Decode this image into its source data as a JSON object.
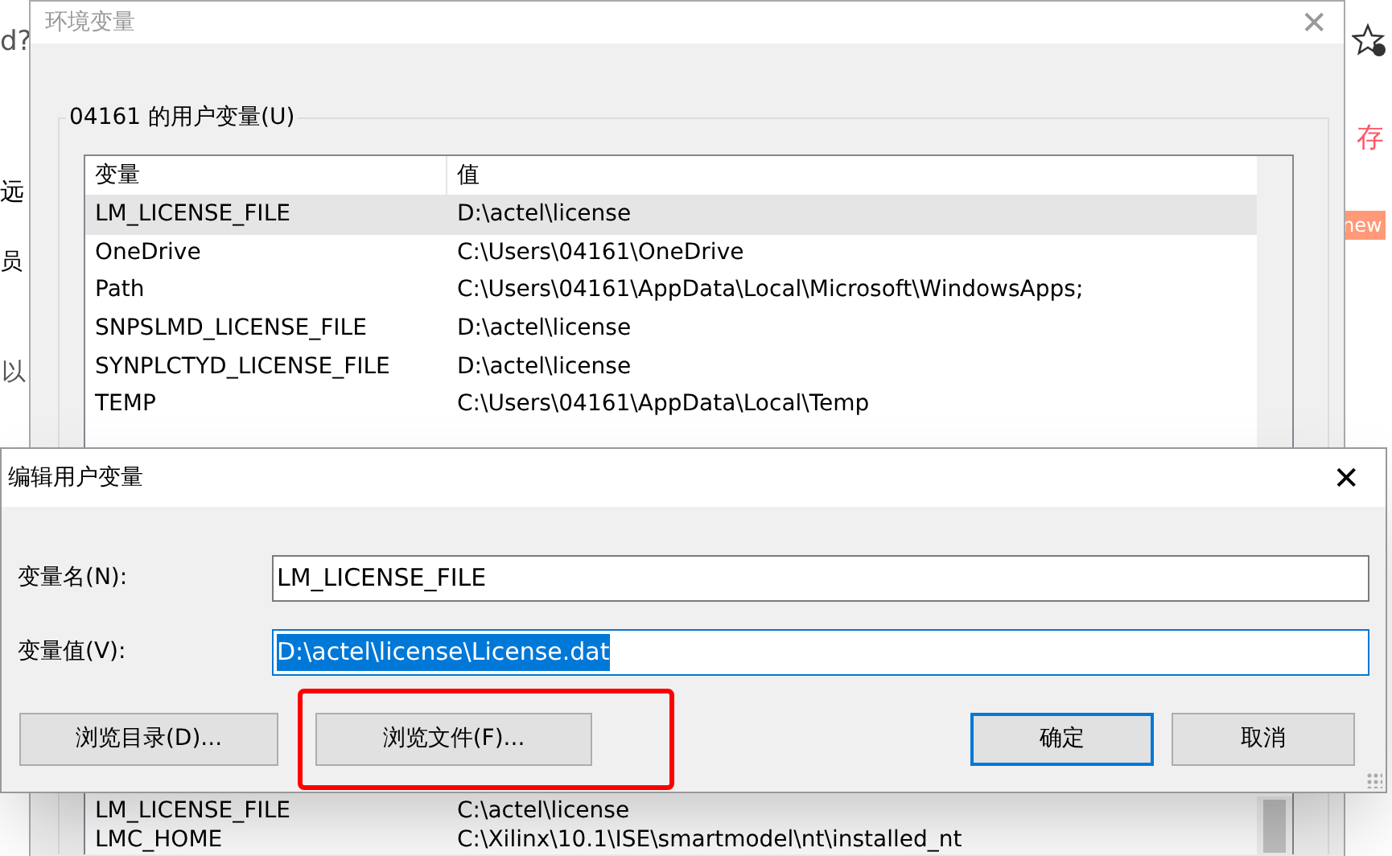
{
  "background_page": {
    "fragments": [
      {
        "text": "d?"
      },
      {
        "text": "远"
      },
      {
        "text": "员"
      },
      {
        "text": "以"
      }
    ],
    "right_fragments": [
      {
        "text": "存"
      },
      {
        "text": "new"
      }
    ]
  },
  "env_dialog": {
    "title": "环境变量",
    "close_glyph": "✕",
    "group_label": "04161 的用户变量(U)",
    "columns": [
      "变量",
      "值"
    ],
    "rows": [
      {
        "name": "LM_LICENSE_FILE",
        "value": "D:\\actel\\license",
        "selected": true
      },
      {
        "name": "OneDrive",
        "value": "C:\\Users\\04161\\OneDrive",
        "selected": false
      },
      {
        "name": "Path",
        "value": "C:\\Users\\04161\\AppData\\Local\\Microsoft\\WindowsApps;",
        "selected": false
      },
      {
        "name": "SNPSLMD_LICENSE_FILE",
        "value": "D:\\actel\\license",
        "selected": false
      },
      {
        "name": "SYNPLCTYD_LICENSE_FILE",
        "value": "D:\\actel\\license",
        "selected": false
      },
      {
        "name": "TEMP",
        "value": "C:\\Users\\04161\\AppData\\Local\\Temp",
        "selected": false
      }
    ],
    "lower_rows": [
      {
        "name": "LM_LICENSE_FILE",
        "value": "C:\\actel\\license"
      },
      {
        "name": "LMC_HOME",
        "value": "C:\\Xilinx\\10.1\\ISE\\smartmodel\\nt\\installed_nt"
      }
    ]
  },
  "edit_dialog": {
    "title": "编辑用户变量",
    "close_glyph": "✕",
    "fields": [
      {
        "label": "变量名(N):",
        "value": "LM_LICENSE_FILE",
        "text_selected": false
      },
      {
        "label": "变量值(V):",
        "value": "D:\\actel\\license\\License.dat",
        "text_selected": true
      }
    ],
    "buttons": [
      {
        "label": "浏览目录(D)...",
        "default": false,
        "highlighted": false
      },
      {
        "label": "浏览文件(F)...",
        "default": false,
        "highlighted": true
      },
      {
        "label": "确定",
        "default": true,
        "highlighted": false
      },
      {
        "label": "取消",
        "default": false,
        "highlighted": false
      }
    ]
  }
}
